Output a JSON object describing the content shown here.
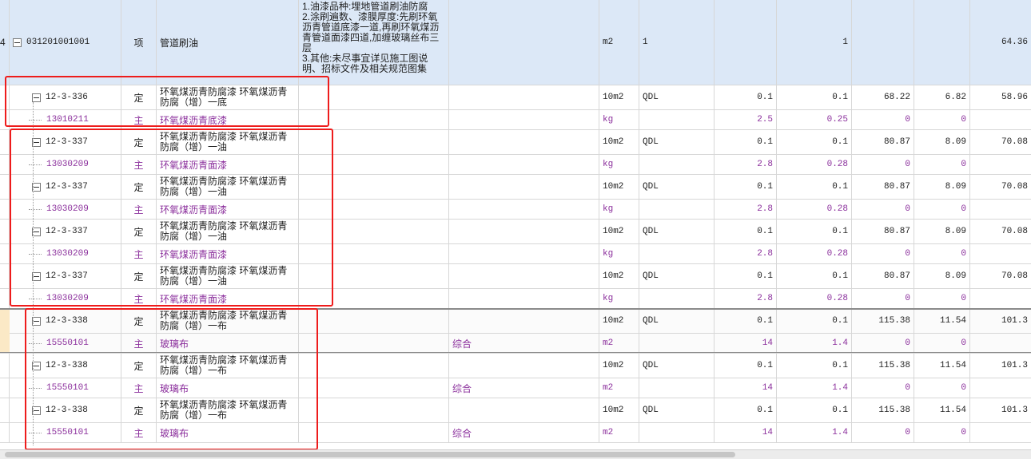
{
  "header_row": {
    "index": "4",
    "code": "031201001001",
    "type": "项",
    "name": "管道刷油",
    "feature": "1.油漆品种:埋地管道刷油防腐\n2.涂刷遍数、漆膜厚度:先刷环氧沥青管道底漆一道,再刷环氧煤沥青管道面漆四道,加缠玻璃丝布三层\n3.其他:未尽事宜详见施工图说明、招标文件及相关规范图集",
    "unit": "m2",
    "formula": "1",
    "qty": "1",
    "amount": "64.36"
  },
  "rows": [
    {
      "kind": "quota",
      "code": "12-3-336",
      "type": "定",
      "name": "环氧煤沥青防腐漆 环氧煤沥青防腐（增）一底",
      "spec": "",
      "unit": "10m2",
      "expr": "QDL",
      "content": "0.1",
      "qty": "0.1",
      "price": "68.22",
      "total": "6.82",
      "unit_price": "58.96"
    },
    {
      "kind": "main",
      "code": "13010211",
      "type": "主",
      "name": "环氧煤沥青底漆",
      "spec": "",
      "unit": "kg",
      "expr": "",
      "content": "2.5",
      "qty": "0.25",
      "price": "0",
      "total": "0",
      "unit_price": ""
    },
    {
      "kind": "quota",
      "code": "12-3-337",
      "type": "定",
      "name": "环氧煤沥青防腐漆 环氧煤沥青防腐（增）一油",
      "spec": "",
      "unit": "10m2",
      "expr": "QDL",
      "content": "0.1",
      "qty": "0.1",
      "price": "80.87",
      "total": "8.09",
      "unit_price": "70.08"
    },
    {
      "kind": "main",
      "code": "13030209",
      "type": "主",
      "name": "环氧煤沥青面漆",
      "spec": "",
      "unit": "kg",
      "expr": "",
      "content": "2.8",
      "qty": "0.28",
      "price": "0",
      "total": "0",
      "unit_price": ""
    },
    {
      "kind": "quota",
      "code": "12-3-337",
      "type": "定",
      "name": "环氧煤沥青防腐漆 环氧煤沥青防腐（增）一油",
      "spec": "",
      "unit": "10m2",
      "expr": "QDL",
      "content": "0.1",
      "qty": "0.1",
      "price": "80.87",
      "total": "8.09",
      "unit_price": "70.08"
    },
    {
      "kind": "main",
      "code": "13030209",
      "type": "主",
      "name": "环氧煤沥青面漆",
      "spec": "",
      "unit": "kg",
      "expr": "",
      "content": "2.8",
      "qty": "0.28",
      "price": "0",
      "total": "0",
      "unit_price": ""
    },
    {
      "kind": "quota",
      "code": "12-3-337",
      "type": "定",
      "name": "环氧煤沥青防腐漆 环氧煤沥青防腐（增）一油",
      "spec": "",
      "unit": "10m2",
      "expr": "QDL",
      "content": "0.1",
      "qty": "0.1",
      "price": "80.87",
      "total": "8.09",
      "unit_price": "70.08"
    },
    {
      "kind": "main",
      "code": "13030209",
      "type": "主",
      "name": "环氧煤沥青面漆",
      "spec": "",
      "unit": "kg",
      "expr": "",
      "content": "2.8",
      "qty": "0.28",
      "price": "0",
      "total": "0",
      "unit_price": ""
    },
    {
      "kind": "quota",
      "code": "12-3-337",
      "type": "定",
      "name": "环氧煤沥青防腐漆 环氧煤沥青防腐（增）一油",
      "spec": "",
      "unit": "10m2",
      "expr": "QDL",
      "content": "0.1",
      "qty": "0.1",
      "price": "80.87",
      "total": "8.09",
      "unit_price": "70.08"
    },
    {
      "kind": "main",
      "code": "13030209",
      "type": "主",
      "name": "环氧煤沥青面漆",
      "spec": "",
      "unit": "kg",
      "expr": "",
      "content": "2.8",
      "qty": "0.28",
      "price": "0",
      "total": "0",
      "unit_price": ""
    },
    {
      "kind": "quota",
      "code": "12-3-338",
      "type": "定",
      "name": "环氧煤沥青防腐漆 环氧煤沥青防腐（增）一布",
      "spec": "",
      "unit": "10m2",
      "expr": "QDL",
      "content": "0.1",
      "qty": "0.1",
      "price": "115.38",
      "total": "11.54",
      "unit_price": "101.3"
    },
    {
      "kind": "main",
      "code": "15550101",
      "type": "主",
      "name": "玻璃布",
      "spec": "综合",
      "unit": "m2",
      "expr": "",
      "content": "14",
      "qty": "1.4",
      "price": "0",
      "total": "0",
      "unit_price": ""
    },
    {
      "kind": "quota",
      "code": "12-3-338",
      "type": "定",
      "name": "环氧煤沥青防腐漆 环氧煤沥青防腐（增）一布",
      "spec": "",
      "unit": "10m2",
      "expr": "QDL",
      "content": "0.1",
      "qty": "0.1",
      "price": "115.38",
      "total": "11.54",
      "unit_price": "101.3"
    },
    {
      "kind": "main",
      "code": "15550101",
      "type": "主",
      "name": "玻璃布",
      "spec": "综合",
      "unit": "m2",
      "expr": "",
      "content": "14",
      "qty": "1.4",
      "price": "0",
      "total": "0",
      "unit_price": ""
    },
    {
      "kind": "quota",
      "code": "12-3-338",
      "type": "定",
      "name": "环氧煤沥青防腐漆 环氧煤沥青防腐（增）一布",
      "spec": "",
      "unit": "10m2",
      "expr": "QDL",
      "content": "0.1",
      "qty": "0.1",
      "price": "115.38",
      "total": "11.54",
      "unit_price": "101.3"
    },
    {
      "kind": "main",
      "code": "15550101",
      "type": "主",
      "name": "玻璃布",
      "spec": "综合",
      "unit": "m2",
      "expr": "",
      "content": "14",
      "qty": "1.4",
      "price": "0",
      "total": "0",
      "unit_price": ""
    }
  ],
  "colors": {
    "header_bg": "#dce8f7",
    "main_material_text": "#8b2f9c",
    "annotation_box": "#ee1c1c",
    "grid_line": "#d7d7d7"
  }
}
